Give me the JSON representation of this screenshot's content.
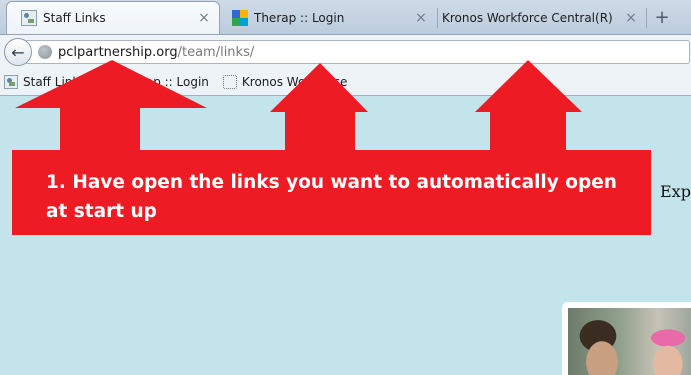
{
  "browser": {
    "tabs": [
      {
        "title": "Staff Links",
        "icon": "pcl-favicon",
        "active": true
      },
      {
        "title": "Therap :: Login",
        "icon": "therap-favicon",
        "active": false
      },
      {
        "title": "Kronos Workforce Central(R)",
        "icon": "blank-favicon",
        "active": false
      }
    ],
    "tab_close_glyph": "×",
    "new_tab_glyph": "+",
    "back_glyph": "←",
    "url": {
      "domain": "pclpartnership.org",
      "path": "/team/links/"
    },
    "bookmarks": [
      {
        "label": "Staff Links",
        "icon": "pcl-favicon"
      },
      {
        "label": "Therap :: Login",
        "icon": "therap-favicon"
      },
      {
        "label": "Kronos Workforce",
        "icon": "dotted-favicon"
      }
    ]
  },
  "page": {
    "heading_fragment": "Exp"
  },
  "annotation": {
    "text": "1. Have open the links you want to automatically open at start up",
    "color": "#ed1c24"
  }
}
